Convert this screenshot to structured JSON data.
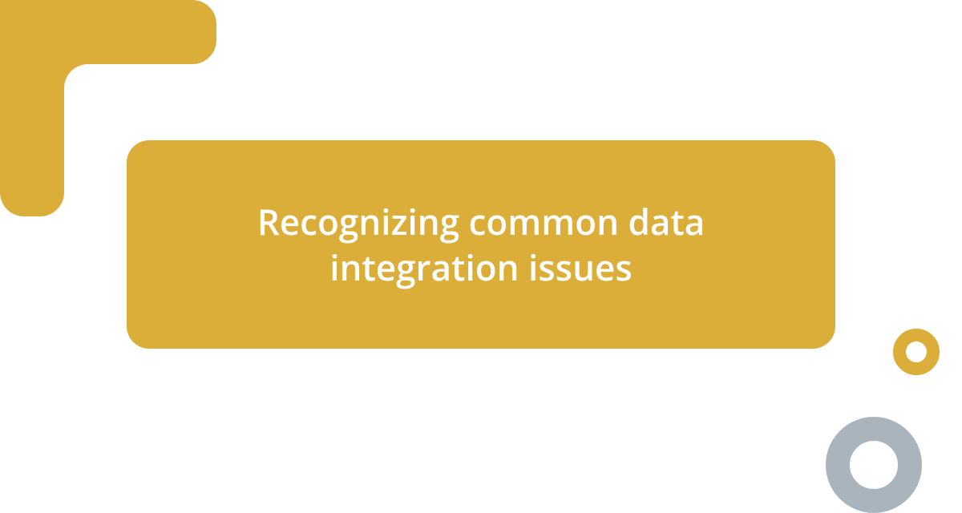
{
  "title": "Recognizing common data integration issues",
  "colors": {
    "accent": "#dbae3a",
    "secondary": "#aab4bd",
    "background": "#ffffff",
    "text": "#ffffff"
  }
}
